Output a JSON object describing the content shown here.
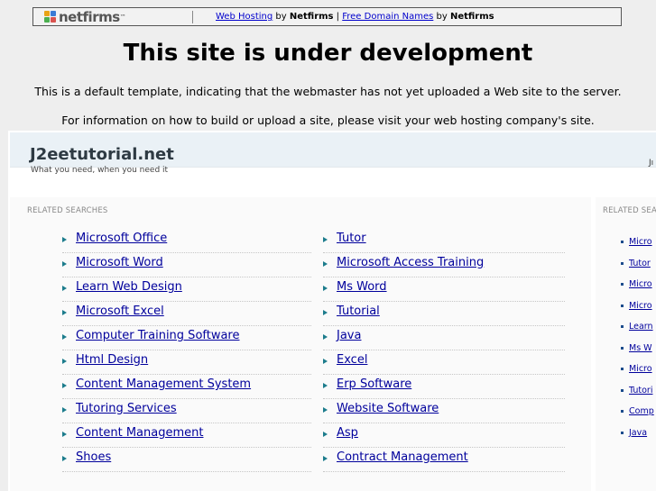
{
  "topbar": {
    "logo_text": "netfirms",
    "logo_tm": "™",
    "link1": "Web Hosting",
    "by1": " by ",
    "brand1": "Netfirms",
    "sep": " | ",
    "link2": "Free Domain Names",
    "by2": " by ",
    "brand2": "Netfirms"
  },
  "heading": "This site is under development",
  "note1": "This is a default template, indicating that the webmaster has not yet uploaded a Web site to the server.",
  "note2": "For information on how to build or upload a site, please visit your web hosting company's site.",
  "site": {
    "name": "J2eetutorial.net",
    "tagline": "What you need, when you need it",
    "cut_text": "Jı"
  },
  "related": {
    "title": "RELATED SEARCHES",
    "side_title": "RELATED SEA",
    "left": [
      "Microsoft Office",
      "Microsoft Word",
      "Learn Web Design",
      "Microsoft Excel",
      "Computer Training Software",
      "Html Design",
      "Content Management System",
      "Tutoring Services",
      "Content Management",
      "Shoes"
    ],
    "right": [
      "Tutor",
      "Microsoft Access Training",
      "Ms Word",
      "Tutorial",
      "Java",
      "Excel",
      "Erp Software",
      "Website Software",
      "Asp",
      "Contract Management"
    ],
    "side": [
      "Micro",
      "Tutor",
      "Micro",
      "Micro",
      "Learn",
      "Ms W",
      "Micro",
      "Tutori",
      "Comp",
      "Java"
    ]
  },
  "colors": {
    "link": "#00009c",
    "arrow": "#1c7c8c",
    "header_bg": "#eaf1f6"
  }
}
